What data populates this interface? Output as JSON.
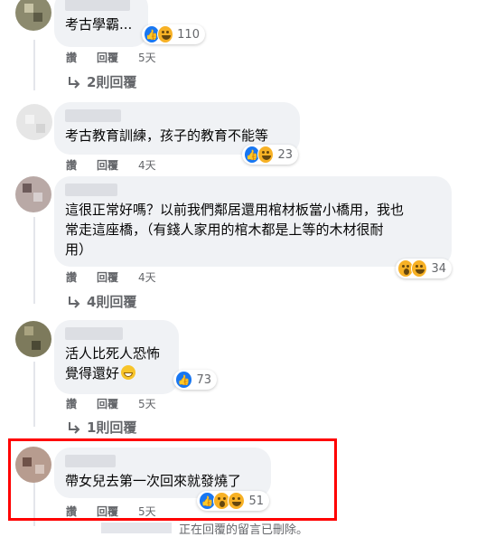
{
  "comments": [
    {
      "text": "考古學霸...",
      "reactions": [
        "like",
        "haha"
      ],
      "count": "110",
      "actions": {
        "like": "讚",
        "reply": "回覆",
        "time": "5天"
      },
      "more_replies": "2則回覆"
    },
    {
      "text": "考古教育訓練，孩子的教育不能等",
      "reactions": [
        "like",
        "haha"
      ],
      "count": "23",
      "actions": {
        "like": "讚",
        "reply": "回覆",
        "time": "4天"
      },
      "more_replies": ""
    },
    {
      "text": "這很正常好嗎？以前我們鄰居還用棺材板當小橋用，我也\n常走這座橋，（有錢人家用的棺木都是上等的木材很耐\n用）",
      "reactions": [
        "wow",
        "haha"
      ],
      "count": "34",
      "actions": {
        "like": "讚",
        "reply": "回覆",
        "time": "4天"
      },
      "more_replies": "4則回覆"
    },
    {
      "text_line1": "活人比死人恐怖",
      "text_line2": "覺得還好",
      "reactions": [
        "like"
      ],
      "count": "73",
      "actions": {
        "like": "讚",
        "reply": "回覆",
        "time": "5天"
      },
      "more_replies": "1則回覆"
    },
    {
      "text": "帶女兒去第一次回來就發燒了",
      "reactions": [
        "like",
        "wow",
        "haha"
      ],
      "count": "51",
      "actions": {
        "like": "讚",
        "reply": "回覆",
        "time": "5天"
      },
      "more_replies": ""
    }
  ],
  "deleted_notice": "正在回覆的留言已刪除。",
  "colors": {
    "highlight": "#ff0000",
    "bubble": "#f0f2f5",
    "meta": "#65676b",
    "like": "#1877f2"
  }
}
